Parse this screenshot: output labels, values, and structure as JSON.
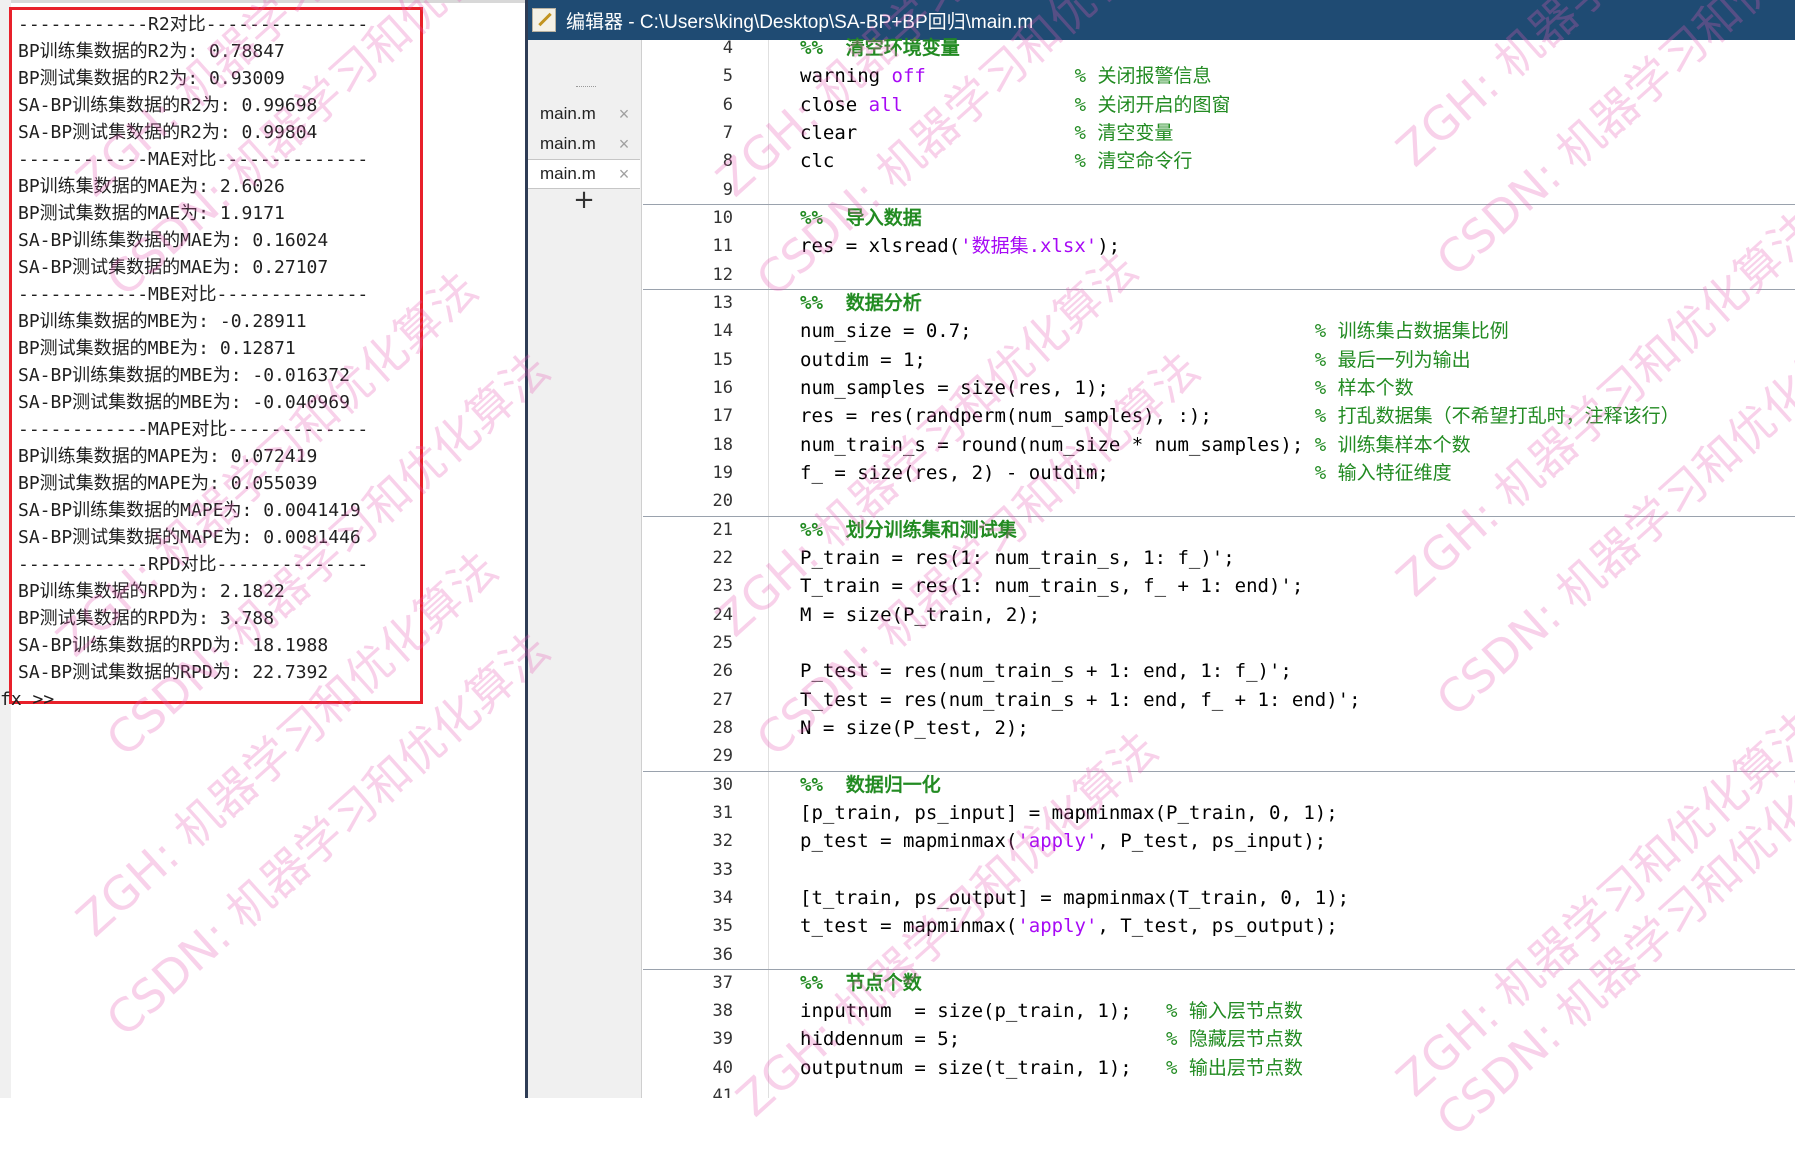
{
  "command_window": {
    "lines": [
      "------------R2对比---------------",
      "BP训练集数据的R2为: 0.78847",
      "BP测试集数据的R2为: 0.93009",
      "SA-BP训练集数据的R2为: 0.99698",
      "SA-BP测试集数据的R2为: 0.99804",
      "------------MAE对比--------------",
      "BP训练集数据的MAE为: 2.6026",
      "BP测试集数据的MAE为: 1.9171",
      "SA-BP训练集数据的MAE为: 0.16024",
      "SA-BP测试集数据的MAE为: 0.27107",
      "------------MBE对比--------------",
      "BP训练集数据的MBE为: -0.28911",
      "BP测试集数据的MBE为: 0.12871",
      "SA-BP训练集数据的MBE为: -0.016372",
      "SA-BP测试集数据的MBE为: -0.040969",
      "------------MAPE对比-------------",
      "BP训练集数据的MAPE为: 0.072419",
      "BP测试集数据的MAPE为: 0.055039",
      "SA-BP训练集数据的MAPE为: 0.0041419",
      "SA-BP测试集数据的MAPE为: 0.0081446",
      "------------RPD对比--------------",
      "BP训练集数据的RPD为: 2.1822",
      "BP测试集数据的RPD为: 3.788",
      "SA-BP训练集数据的RPD为: 18.1988",
      "SA-BP测试集数据的RPD为: 22.7392"
    ],
    "prompt": "fx >>",
    "highlight_color": "#e8202a"
  },
  "editor": {
    "title": "编辑器 - C:\\Users\\king\\Desktop\\SA-BP+BP回归\\main.m",
    "title_icon": "editor-icon",
    "tabs": [
      {
        "label": "main.m",
        "close": "×"
      },
      {
        "label": "main.m",
        "close": "×"
      },
      {
        "label": "main.m",
        "close": "×"
      }
    ],
    "add_tab": "+",
    "line_numbers": [
      "4",
      "5",
      "6",
      "7",
      "8",
      "9",
      "10",
      "11",
      "12",
      "13",
      "14",
      "15",
      "16",
      "17",
      "18",
      "19",
      "20",
      "21",
      "22",
      "23",
      "24",
      "25",
      "26",
      "27",
      "28",
      "29",
      "30",
      "31",
      "32",
      "33",
      "34",
      "35",
      "36",
      "37",
      "38",
      "39",
      "40",
      "41"
    ],
    "code_lines": [
      {
        "segments": [
          {
            "t": "%%  清空环境变量",
            "c": "cell"
          }
        ]
      },
      {
        "segments": [
          {
            "t": "warning ",
            "c": ""
          },
          {
            "t": "off",
            "c": "str"
          },
          {
            "t": "             ",
            "c": ""
          },
          {
            "t": "% 关闭报警信息",
            "c": "cmt"
          }
        ]
      },
      {
        "segments": [
          {
            "t": "close ",
            "c": ""
          },
          {
            "t": "all",
            "c": "str"
          },
          {
            "t": "               ",
            "c": ""
          },
          {
            "t": "% 关闭开启的图窗",
            "c": "cmt"
          }
        ]
      },
      {
        "segments": [
          {
            "t": "clear                   ",
            "c": ""
          },
          {
            "t": "% 清空变量",
            "c": "cmt"
          }
        ]
      },
      {
        "segments": [
          {
            "t": "clc                     ",
            "c": ""
          },
          {
            "t": "% 清空命令行",
            "c": "cmt"
          }
        ]
      },
      {
        "segments": [
          {
            "t": "",
            "c": ""
          }
        ]
      },
      {
        "segments": [
          {
            "t": "%%  导入数据",
            "c": "cell"
          }
        ]
      },
      {
        "segments": [
          {
            "t": "res = xlsread(",
            "c": ""
          },
          {
            "t": "'数据集.xlsx'",
            "c": "str"
          },
          {
            "t": ");",
            "c": ""
          }
        ]
      },
      {
        "segments": [
          {
            "t": "",
            "c": ""
          }
        ]
      },
      {
        "segments": [
          {
            "t": "%%  数据分析",
            "c": "cell"
          }
        ]
      },
      {
        "segments": [
          {
            "t": "num_size = 0.7;                              ",
            "c": ""
          },
          {
            "t": "% 训练集占数据集比例",
            "c": "cmt"
          }
        ]
      },
      {
        "segments": [
          {
            "t": "outdim = 1;                                  ",
            "c": ""
          },
          {
            "t": "% 最后一列为输出",
            "c": "cmt"
          }
        ]
      },
      {
        "segments": [
          {
            "t": "num_samples = size(res, 1);                  ",
            "c": ""
          },
          {
            "t": "% 样本个数",
            "c": "cmt"
          }
        ]
      },
      {
        "segments": [
          {
            "t": "res = res(randperm(num_samples), :);         ",
            "c": ""
          },
          {
            "t": "% 打乱数据集（不希望打乱时，注释该行）",
            "c": "cmt"
          }
        ]
      },
      {
        "segments": [
          {
            "t": "num_train_s = round(num_size * num_samples); ",
            "c": ""
          },
          {
            "t": "% 训练集样本个数",
            "c": "cmt"
          }
        ]
      },
      {
        "segments": [
          {
            "t": "f_ = size(res, 2) - outdim;                  ",
            "c": ""
          },
          {
            "t": "% 输入特征维度",
            "c": "cmt"
          }
        ]
      },
      {
        "segments": [
          {
            "t": "",
            "c": ""
          }
        ]
      },
      {
        "segments": [
          {
            "t": "%%  划分训练集和测试集",
            "c": "cell"
          }
        ]
      },
      {
        "segments": [
          {
            "t": "P_train = res(1: num_train_s, 1: f_)';",
            "c": ""
          }
        ]
      },
      {
        "segments": [
          {
            "t": "T_train = res(1: num_train_s, f_ + 1: end)';",
            "c": ""
          }
        ]
      },
      {
        "segments": [
          {
            "t": "M = size(P_train, 2);",
            "c": ""
          }
        ]
      },
      {
        "segments": [
          {
            "t": "",
            "c": ""
          }
        ]
      },
      {
        "segments": [
          {
            "t": "P_test = res(num_train_s + 1: end, 1: f_)';",
            "c": ""
          }
        ]
      },
      {
        "segments": [
          {
            "t": "T_test = res(num_train_s + 1: end, f_ + 1: end)';",
            "c": ""
          }
        ]
      },
      {
        "segments": [
          {
            "t": "N = size(P_test, 2);",
            "c": ""
          }
        ]
      },
      {
        "segments": [
          {
            "t": "",
            "c": ""
          }
        ]
      },
      {
        "segments": [
          {
            "t": "%%  数据归一化",
            "c": "cell"
          }
        ]
      },
      {
        "segments": [
          {
            "t": "[p_train, ps_input] = mapminmax(P_train, 0, 1);",
            "c": ""
          }
        ]
      },
      {
        "segments": [
          {
            "t": "p_test = mapminmax(",
            "c": ""
          },
          {
            "t": "'apply'",
            "c": "str"
          },
          {
            "t": ", P_test, ps_input);",
            "c": ""
          }
        ]
      },
      {
        "segments": [
          {
            "t": "",
            "c": ""
          }
        ]
      },
      {
        "segments": [
          {
            "t": "[t_train, ps_output] = mapminmax(T_train, 0, 1);",
            "c": ""
          }
        ]
      },
      {
        "segments": [
          {
            "t": "t_test = mapminmax(",
            "c": ""
          },
          {
            "t": "'apply'",
            "c": "str"
          },
          {
            "t": ", T_test, ps_output);",
            "c": ""
          }
        ]
      },
      {
        "segments": [
          {
            "t": "",
            "c": ""
          }
        ]
      },
      {
        "segments": [
          {
            "t": "%%  节点个数",
            "c": "cell"
          }
        ]
      },
      {
        "segments": [
          {
            "t": "inputnum  = size(p_train, 1);   ",
            "c": ""
          },
          {
            "t": "% 输入层节点数",
            "c": "cmt"
          }
        ]
      },
      {
        "segments": [
          {
            "t": "hiddennum = 5;                  ",
            "c": ""
          },
          {
            "t": "% 隐藏层节点数",
            "c": "cmt"
          }
        ]
      },
      {
        "segments": [
          {
            "t": "outputnum = size(t_train, 1);   ",
            "c": ""
          },
          {
            "t": "% 输出层节点数",
            "c": "cmt"
          }
        ]
      },
      {
        "segments": [
          {
            "t": "",
            "c": ""
          }
        ]
      }
    ],
    "section_separator_after": [
      "9",
      "12",
      "20",
      "29",
      "36"
    ]
  },
  "watermark": {
    "text_a": "ZGH: 机器学习和优化算法",
    "text_b": "CSDN: 机器学习和优化算法",
    "color": "#e75ab4"
  },
  "colors": {
    "title_bar": "#1f4b73",
    "keyword_string": "#a709f5",
    "comment": "#228b22"
  }
}
